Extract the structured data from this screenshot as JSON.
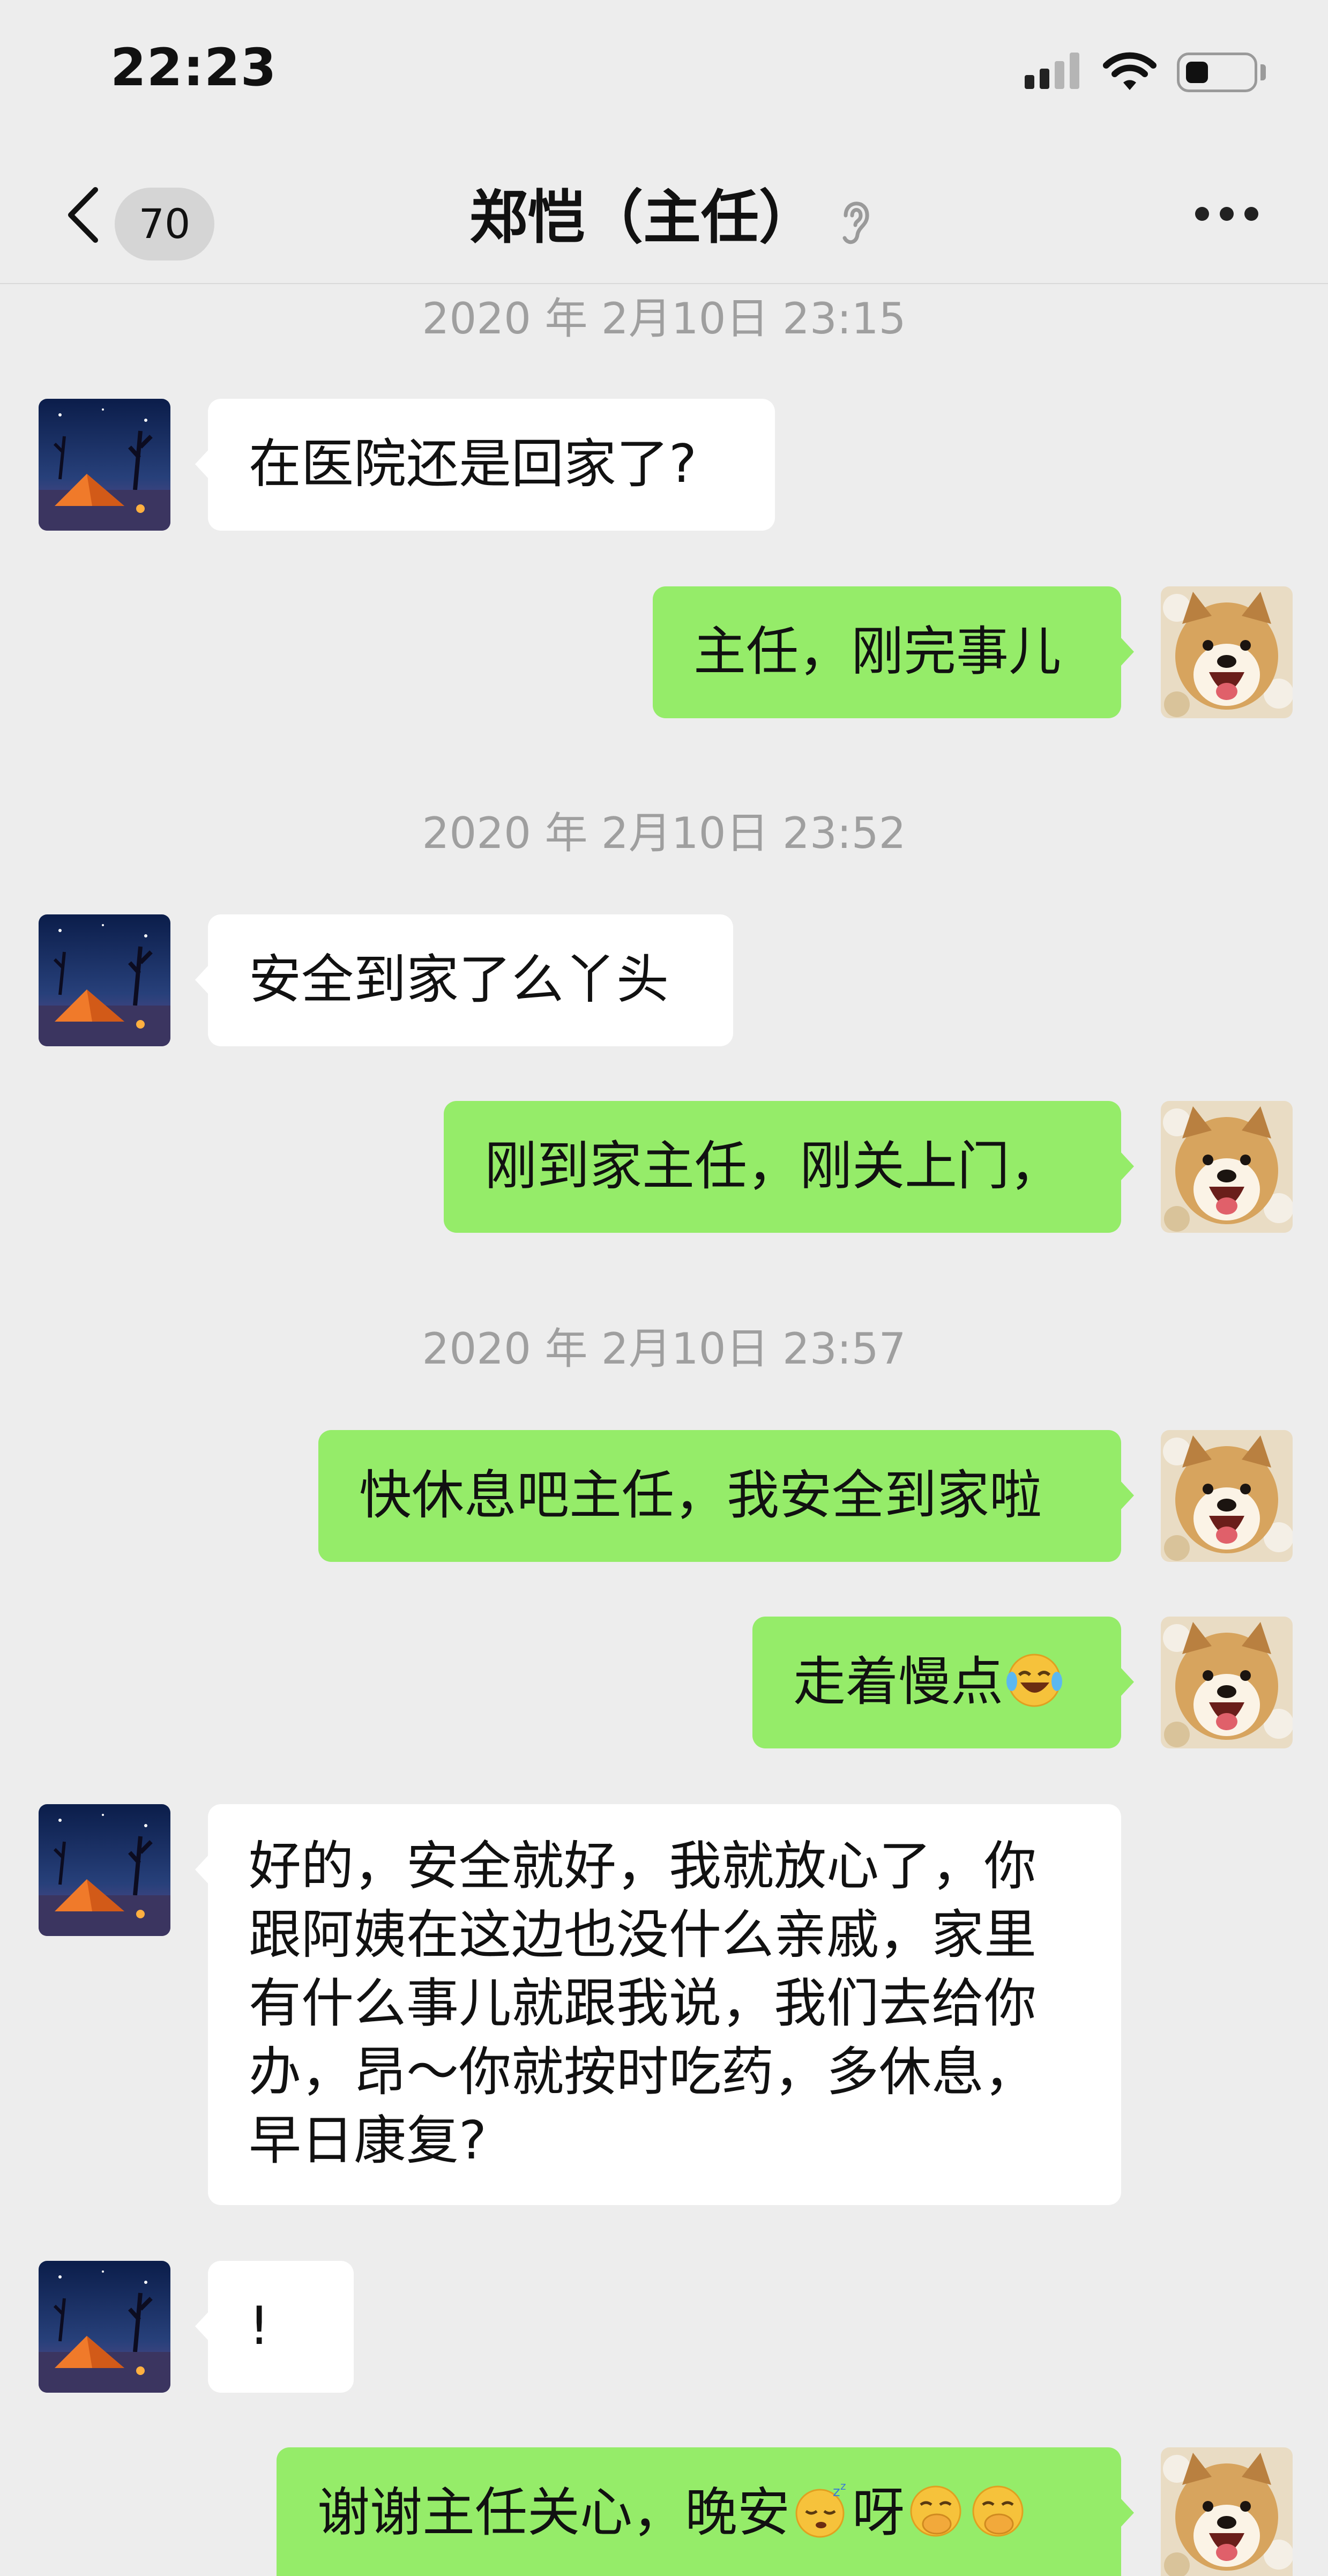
{
  "status_bar": {
    "time": "22:23",
    "battery_level": 0.35
  },
  "header": {
    "unread_count": "70",
    "title": "郑恺（主任）"
  },
  "messages": [
    {
      "type": "timestamp",
      "text": "2020 年 2月10日 23:15"
    },
    {
      "type": "incoming",
      "text": "在医院还是回家了?"
    },
    {
      "type": "outgoing",
      "text": "主任，刚完事儿"
    },
    {
      "type": "timestamp",
      "text": "2020 年 2月10日 23:52"
    },
    {
      "type": "incoming",
      "text": "安全到家了么丫头"
    },
    {
      "type": "outgoing",
      "text": "刚到家主任，刚关上门，"
    },
    {
      "type": "timestamp",
      "text": "2020 年 2月10日 23:57"
    },
    {
      "type": "outgoing",
      "text": "快休息吧主任，我安全到家啦"
    },
    {
      "type": "outgoing",
      "text": "走着慢点",
      "emojis": [
        "laughing-crying-emoji"
      ]
    },
    {
      "type": "incoming",
      "lines": [
        "好的，安全就好，我就放心了，你",
        "跟阿姨在这边也没什么亲戚，家里",
        "有什么事儿就跟我说，我们去给你",
        "办，昂～你就按时吃药，多休息，",
        "早日康复?"
      ]
    },
    {
      "type": "incoming",
      "text": "!"
    },
    {
      "type": "outgoing",
      "text_a": "谢谢主任关心，晚安",
      "text_b": "呀",
      "emojis": [
        "sleeping-emoji",
        "hand-over-mouth-emoji",
        "hand-over-mouth-emoji"
      ]
    }
  ],
  "colors": {
    "background": "#ededed",
    "outgoing_bubble": "#95ec69",
    "incoming_bubble": "#ffffff",
    "timestamp": "#9f9f9f"
  }
}
